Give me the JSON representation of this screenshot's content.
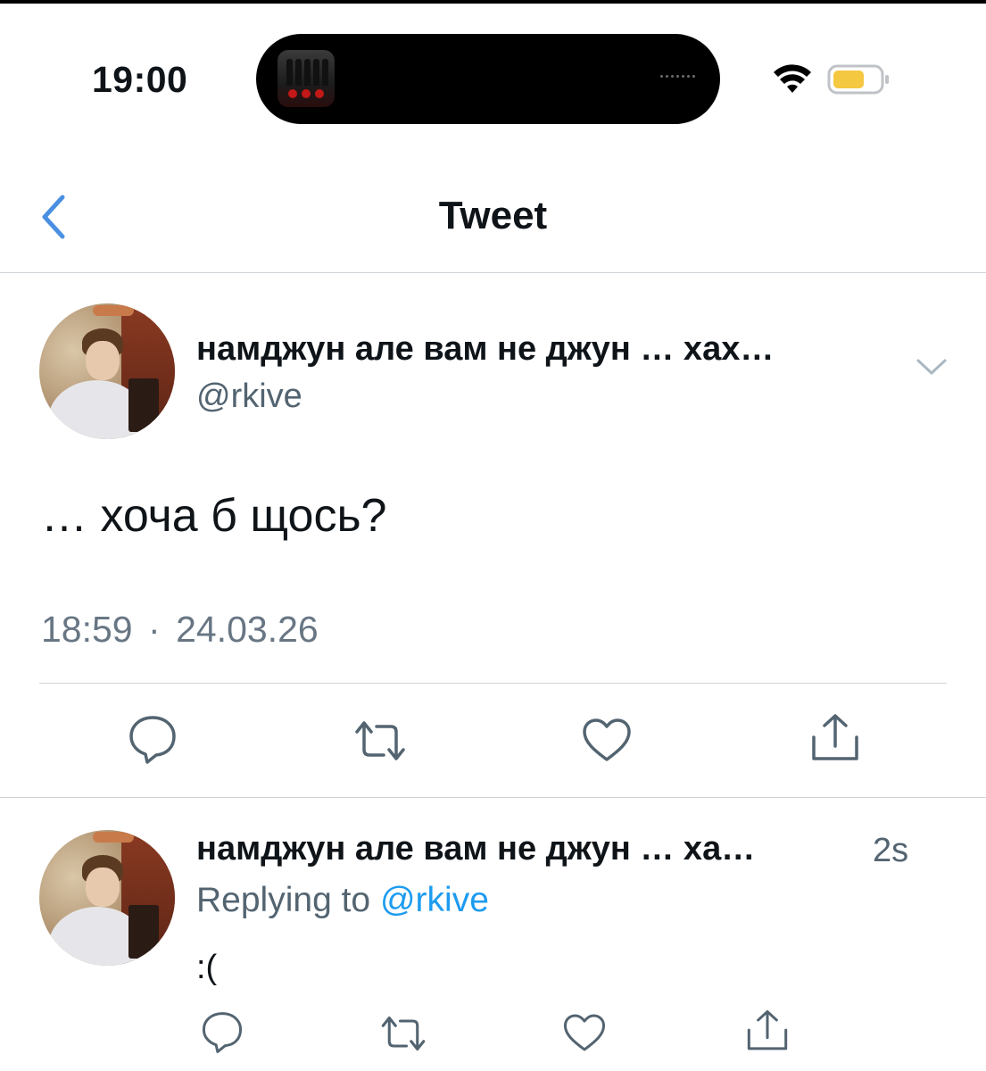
{
  "status_bar": {
    "time": "19:00",
    "icons": [
      "now-playing-artwork-icon",
      "wifi-icon",
      "battery-icon"
    ]
  },
  "nav": {
    "title": "Tweet",
    "back_icon": "chevron-left-icon"
  },
  "tweet": {
    "author_name": "намджун але вам не джун … хах…",
    "handle": "@rkive",
    "text": "… хоча б щось?",
    "time": "18:59",
    "separator": "·",
    "date": "24.03.26",
    "actions": [
      "reply-icon",
      "retweet-icon",
      "like-icon",
      "share-icon"
    ]
  },
  "reply": {
    "author_name": "намджун але вам не джун … ха…",
    "age": "2s",
    "replying_prefix": "Replying to",
    "replying_handle": "@rkive",
    "text": ":("
  },
  "colors": {
    "accent": "#1d9bf0",
    "back_icon": "#4a90e2",
    "secondary_text": "#536471",
    "icon_gray": "#536471",
    "battery": "#f5c842"
  }
}
